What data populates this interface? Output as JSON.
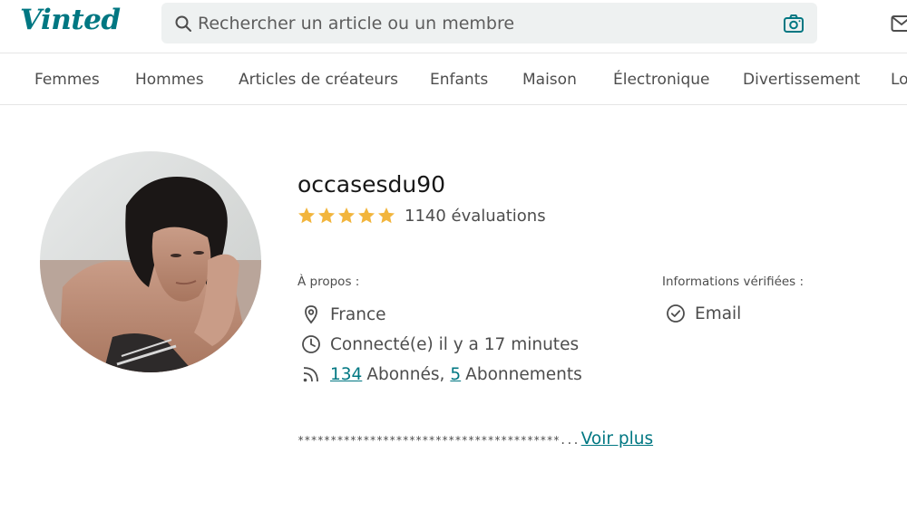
{
  "header": {
    "logo": "Vinted",
    "search_placeholder": "Rechercher un article ou un membre"
  },
  "nav": {
    "items": [
      {
        "label": "Femmes"
      },
      {
        "label": "Hommes"
      },
      {
        "label": "Articles de créateurs"
      },
      {
        "label": "Enfants"
      },
      {
        "label": "Maison"
      },
      {
        "label": "Électronique"
      },
      {
        "label": "Divertissement"
      },
      {
        "label": "Lo"
      }
    ]
  },
  "profile": {
    "username": "occasesdu90",
    "rating_stars": 5,
    "reviews": "1140 évaluations",
    "about_label": "À propos :",
    "location": "France",
    "last_seen": "Connecté(e) il y a 17 minutes",
    "followers_count": "134",
    "followers_label": "Abonnés,",
    "following_count": "5",
    "following_label": "Abonnements",
    "verified_label": "Informations vérifiées :",
    "verified_email": "Email",
    "bio": "****************************************...",
    "see_more": "Voir plus"
  },
  "colors": {
    "brand": "#007782",
    "star": "#f2b53c",
    "search_bg": "#eef1f1",
    "text_muted": "#4d4d4d"
  },
  "icons": [
    "search-icon",
    "camera-icon",
    "mail-icon",
    "star-icon",
    "location-pin-icon",
    "clock-icon",
    "rss-icon",
    "check-circle-icon"
  ]
}
